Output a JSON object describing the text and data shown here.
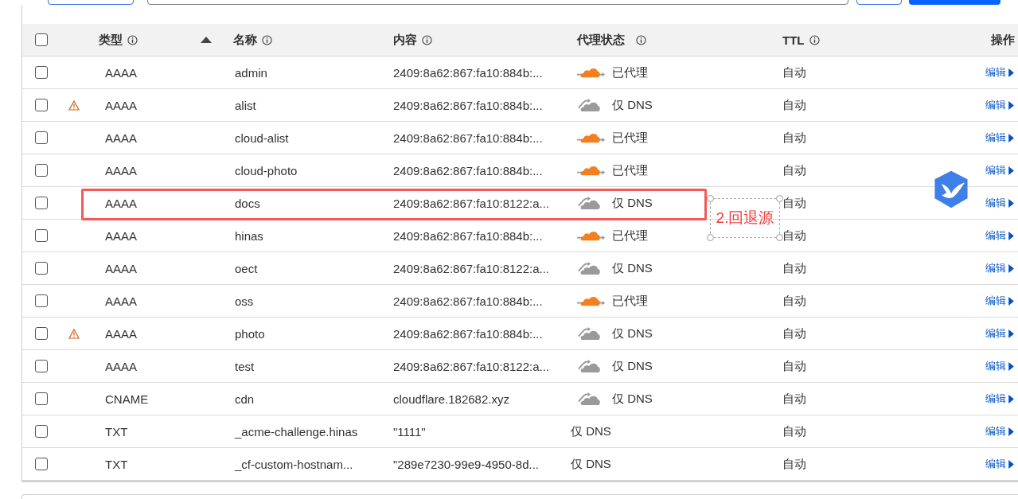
{
  "table": {
    "all_checked": false,
    "columns": [
      {
        "label": "类型",
        "info": true,
        "sorted": true
      },
      {
        "label": "名称",
        "info": true,
        "sorted": false
      },
      {
        "label": "内容",
        "info": true,
        "sorted": false
      },
      {
        "label": "代理状态",
        "info": true,
        "sorted": false
      },
      {
        "label": "TTL",
        "info": true,
        "sorted": false
      },
      {
        "label": "操作",
        "info": false,
        "sorted": false
      }
    ],
    "rows": [
      {
        "checked": false,
        "warning": false,
        "type": "AAAA",
        "name": "admin",
        "content": "2409:8a62:867:fa10:884b:...",
        "proxy": {
          "kind": "proxied",
          "label": "已代理"
        },
        "ttl": "自动",
        "action": "编辑"
      },
      {
        "checked": false,
        "warning": true,
        "type": "AAAA",
        "name": "alist",
        "content": "2409:8a62:867:fa10:884b:...",
        "proxy": {
          "kind": "dns_only",
          "label": "仅 DNS"
        },
        "ttl": "自动",
        "action": "编辑"
      },
      {
        "checked": false,
        "warning": false,
        "type": "AAAA",
        "name": "cloud-alist",
        "content": "2409:8a62:867:fa10:884b:...",
        "proxy": {
          "kind": "proxied",
          "label": "已代理"
        },
        "ttl": "自动",
        "action": "编辑"
      },
      {
        "checked": false,
        "warning": false,
        "type": "AAAA",
        "name": "cloud-photo",
        "content": "2409:8a62:867:fa10:884b:...",
        "proxy": {
          "kind": "proxied",
          "label": "已代理"
        },
        "ttl": "自动",
        "action": "编辑"
      },
      {
        "checked": false,
        "highlighted": true,
        "warning": false,
        "type": "AAAA",
        "name": "docs",
        "content": "2409:8a62:867:fa10:8122:a...",
        "proxy": {
          "kind": "dns_only",
          "label": "仅 DNS"
        },
        "ttl": "自动",
        "action": "编辑"
      },
      {
        "checked": false,
        "warning": false,
        "type": "AAAA",
        "name": "hinas",
        "content": "2409:8a62:867:fa10:884b:...",
        "proxy": {
          "kind": "proxied",
          "label": "已代理"
        },
        "ttl": "自动",
        "action": "编辑"
      },
      {
        "checked": false,
        "warning": false,
        "type": "AAAA",
        "name": "oect",
        "content": "2409:8a62:867:fa10:8122:a...",
        "proxy": {
          "kind": "dns_only",
          "label": "仅 DNS"
        },
        "ttl": "自动",
        "action": "编辑"
      },
      {
        "checked": false,
        "warning": false,
        "type": "AAAA",
        "name": "oss",
        "content": "2409:8a62:867:fa10:884b:...",
        "proxy": {
          "kind": "proxied",
          "label": "已代理"
        },
        "ttl": "自动",
        "action": "编辑"
      },
      {
        "checked": false,
        "warning": true,
        "type": "AAAA",
        "name": "photo",
        "content": "2409:8a62:867:fa10:884b:...",
        "proxy": {
          "kind": "dns_only",
          "label": "仅 DNS"
        },
        "ttl": "自动",
        "action": "编辑"
      },
      {
        "checked": false,
        "warning": false,
        "type": "AAAA",
        "name": "test",
        "content": "2409:8a62:867:fa10:8122:a...",
        "proxy": {
          "kind": "dns_only",
          "label": "仅 DNS"
        },
        "ttl": "自动",
        "action": "编辑"
      },
      {
        "checked": false,
        "warning": false,
        "type": "CNAME",
        "name": "cdn",
        "content": "cloudflare.182682.xyz",
        "proxy": {
          "kind": "dns_only",
          "label": "仅 DNS"
        },
        "ttl": "自动",
        "action": "编辑"
      },
      {
        "checked": false,
        "warning": false,
        "type": "TXT",
        "name": "_acme-challenge.hinas",
        "content": "\"1111\"",
        "proxy": {
          "kind": "text",
          "label": "仅 DNS"
        },
        "ttl": "自动",
        "action": "编辑"
      },
      {
        "checked": false,
        "warning": false,
        "type": "TXT",
        "name": "_cf-custom-hostnam...",
        "content": "\"289e7230-99e9-4950-8d...",
        "proxy": {
          "kind": "text",
          "label": "仅 DNS"
        },
        "ttl": "自动",
        "action": "编辑"
      }
    ]
  },
  "annotation": {
    "label": "2.回退源"
  }
}
